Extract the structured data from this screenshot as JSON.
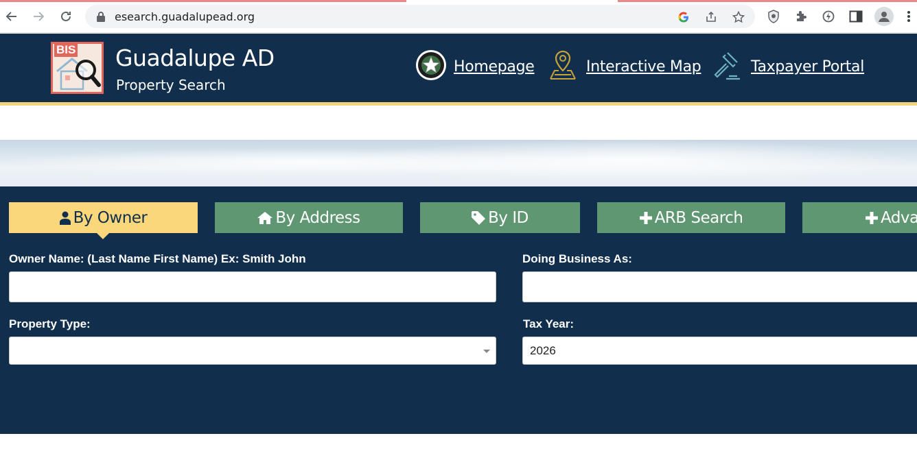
{
  "browser": {
    "url": "esearch.guadalupead.org"
  },
  "header": {
    "logo_text": "BIS",
    "title": "Guadalupe AD",
    "subtitle": "Property Search",
    "nav": [
      {
        "label": "Homepage",
        "icon": "star-seal-icon"
      },
      {
        "label": "Interactive Map",
        "icon": "map-pin-icon"
      },
      {
        "label": "Taxpayer Portal",
        "icon": "gavel-icon"
      }
    ]
  },
  "tabs": [
    {
      "label": "By Owner",
      "icon": "user-icon",
      "active": true
    },
    {
      "label": "By Address",
      "icon": "home-icon",
      "active": false
    },
    {
      "label": "By ID",
      "icon": "tag-icon",
      "active": false
    },
    {
      "label": "ARB Search",
      "icon": "plus-icon",
      "active": false
    },
    {
      "label": "Advan",
      "icon": "plus-icon",
      "active": false
    }
  ],
  "form": {
    "owner_name_label": "Owner Name: (Last Name First Name) Ex: Smith John",
    "owner_name_value": "",
    "dba_label": "Doing Business As:",
    "dba_value": "",
    "property_type_label": "Property Type:",
    "property_type_value": "",
    "tax_year_label": "Tax Year:",
    "tax_year_value": "2026"
  },
  "colors": {
    "navy": "#112f4c",
    "tab_green": "#5e9772",
    "tab_active": "#fbd77b",
    "stripe": "#f3d37a"
  }
}
